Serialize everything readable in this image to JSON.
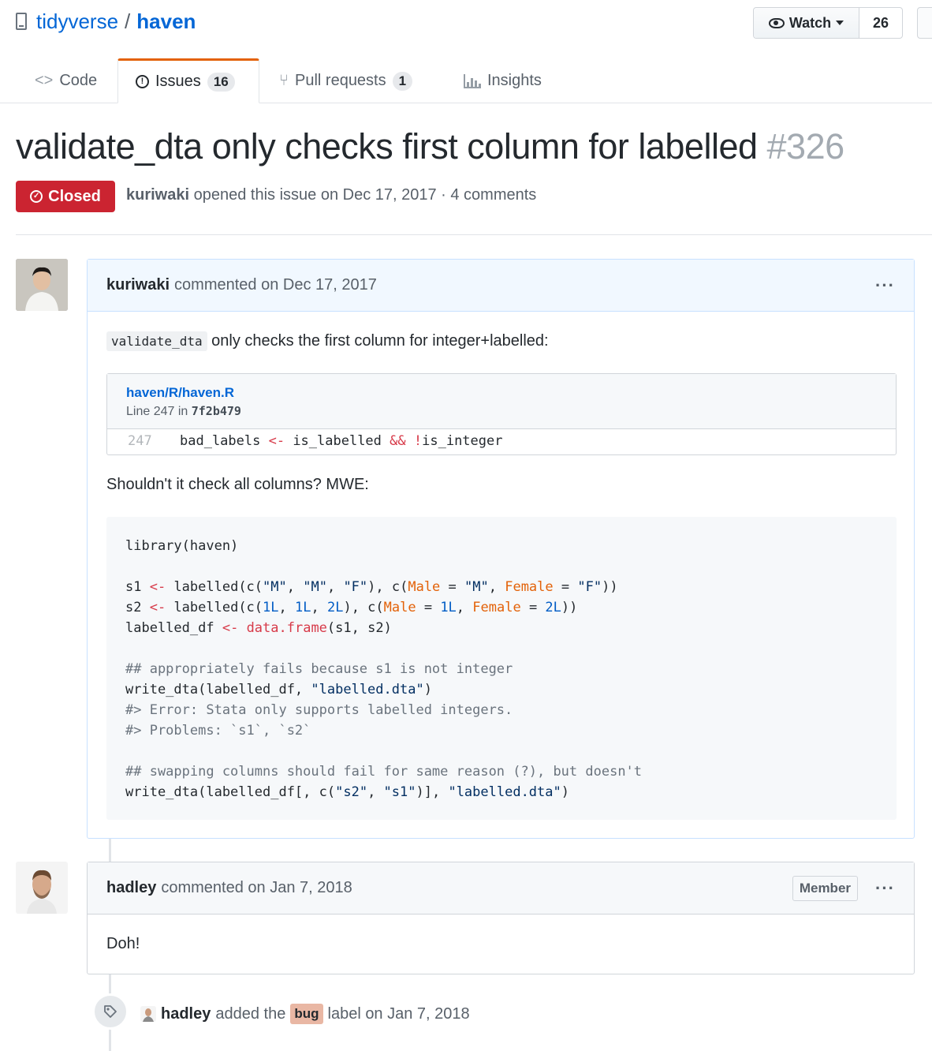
{
  "repo": {
    "owner": "tidyverse",
    "separator": "/",
    "name": "haven"
  },
  "watch": {
    "label": "Watch",
    "count": "26"
  },
  "tabs": [
    {
      "label": "Code",
      "icon": "code-icon"
    },
    {
      "label": "Issues",
      "icon": "issue-icon",
      "count": "16"
    },
    {
      "label": "Pull requests",
      "icon": "pull-request-icon",
      "count": "1"
    },
    {
      "label": "Insights",
      "icon": "graph-icon"
    }
  ],
  "issue": {
    "title": "validate_dta only checks first column for labelled",
    "number": "#326",
    "state": "Closed",
    "author": "kuriwaki",
    "meta": "opened this issue on Dec 17, 2017 · 4 comments"
  },
  "comments": [
    {
      "author": "kuriwaki",
      "header": "commented on Dec 17, 2017",
      "intro_code": "validate_dta",
      "intro_text": "only checks the first column for integer+labelled:",
      "snippet": {
        "path": "haven/R/haven.R",
        "line_prefix": "Line 247 in",
        "sha": "7f2b479",
        "line_number": "247",
        "code": "bad_labels <- is_labelled && !is_integer"
      },
      "question": "Shouldn't it check all columns? MWE:",
      "code_lines": [
        "library(haven)",
        "",
        "s1 <- labelled(c(\"M\", \"M\", \"F\"), c(Male = \"M\", Female = \"F\"))",
        "s2 <- labelled(c(1L, 1L, 2L), c(Male = 1L, Female = 2L))",
        "labelled_df <- data.frame(s1, s2)",
        "",
        "## appropriately fails because s1 is not integer",
        "write_dta(labelled_df, \"labelled.dta\")",
        "#> Error: Stata only supports labelled integers.",
        "#> Problems: `s1`, `s2`",
        "",
        "## swapping columns should fail for same reason (?), but doesn't",
        "write_dta(labelled_df[, c(\"s2\", \"s1\")], \"labelled.dta\")"
      ]
    },
    {
      "author": "hadley",
      "header": "commented on Jan 7, 2018",
      "badge": "Member",
      "body": "Doh!"
    }
  ],
  "event": {
    "actor": "hadley",
    "action": "added the",
    "label": "bug",
    "tail": "label on Jan 7, 2018"
  },
  "colors": {
    "closed": "#cb2431",
    "link": "#0366d6",
    "tab_accent": "#e36209",
    "bug_label": "#e9b7a4"
  }
}
